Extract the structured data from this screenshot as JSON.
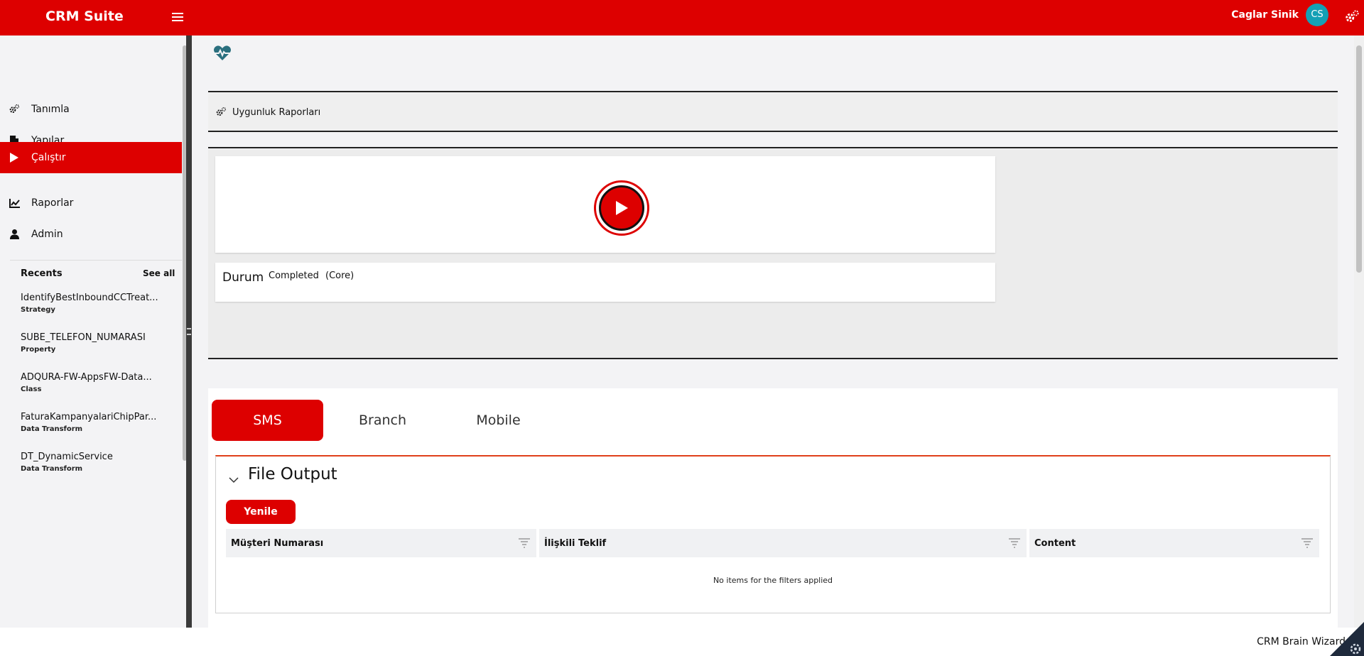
{
  "header": {
    "app_title": "CRM Suite",
    "user_name": "Caglar Sinik",
    "user_initials": "CS",
    "accent_color": "#dd0000"
  },
  "sidebar": {
    "items": [
      {
        "label": "Tanımla",
        "icon": "gears-icon"
      },
      {
        "label": "Yapılar",
        "icon": "file-icon"
      },
      {
        "label": "Çalıştır",
        "icon": "play-icon",
        "active": true
      },
      {
        "label": "Raporlar",
        "icon": "chart-line-icon"
      },
      {
        "label": "Admin",
        "icon": "user-icon"
      }
    ],
    "recents_title": "Recents",
    "see_all": "See all",
    "recents": [
      {
        "name": "IdentifyBestInboundCCTreat...",
        "type": "Strategy"
      },
      {
        "name": "SUBE_TELEFON_NUMARASI",
        "type": "Property"
      },
      {
        "name": "ADQURA-FW-AppsFW-Data...",
        "type": "Class"
      },
      {
        "name": "FaturaKampanyalariChipPar...",
        "type": "Data Transform"
      },
      {
        "name": "DT_DynamicService",
        "type": "Data Transform"
      }
    ]
  },
  "main": {
    "report_title": "Uygunluk Raporları",
    "status_label": "Durum",
    "status_value": "Completed",
    "status_core": "(Core)",
    "tabs": [
      {
        "label": "SMS",
        "active": true
      },
      {
        "label": "Branch"
      },
      {
        "label": "Mobile"
      }
    ],
    "output_title": "File Output",
    "refresh_label": "Yenile",
    "columns": [
      "Müşteri Numarası",
      "İlişkili Teklif",
      "Content"
    ],
    "empty_message": "No items for the filters applied"
  },
  "footer": {
    "brand": "CRM Brain Wizard"
  }
}
